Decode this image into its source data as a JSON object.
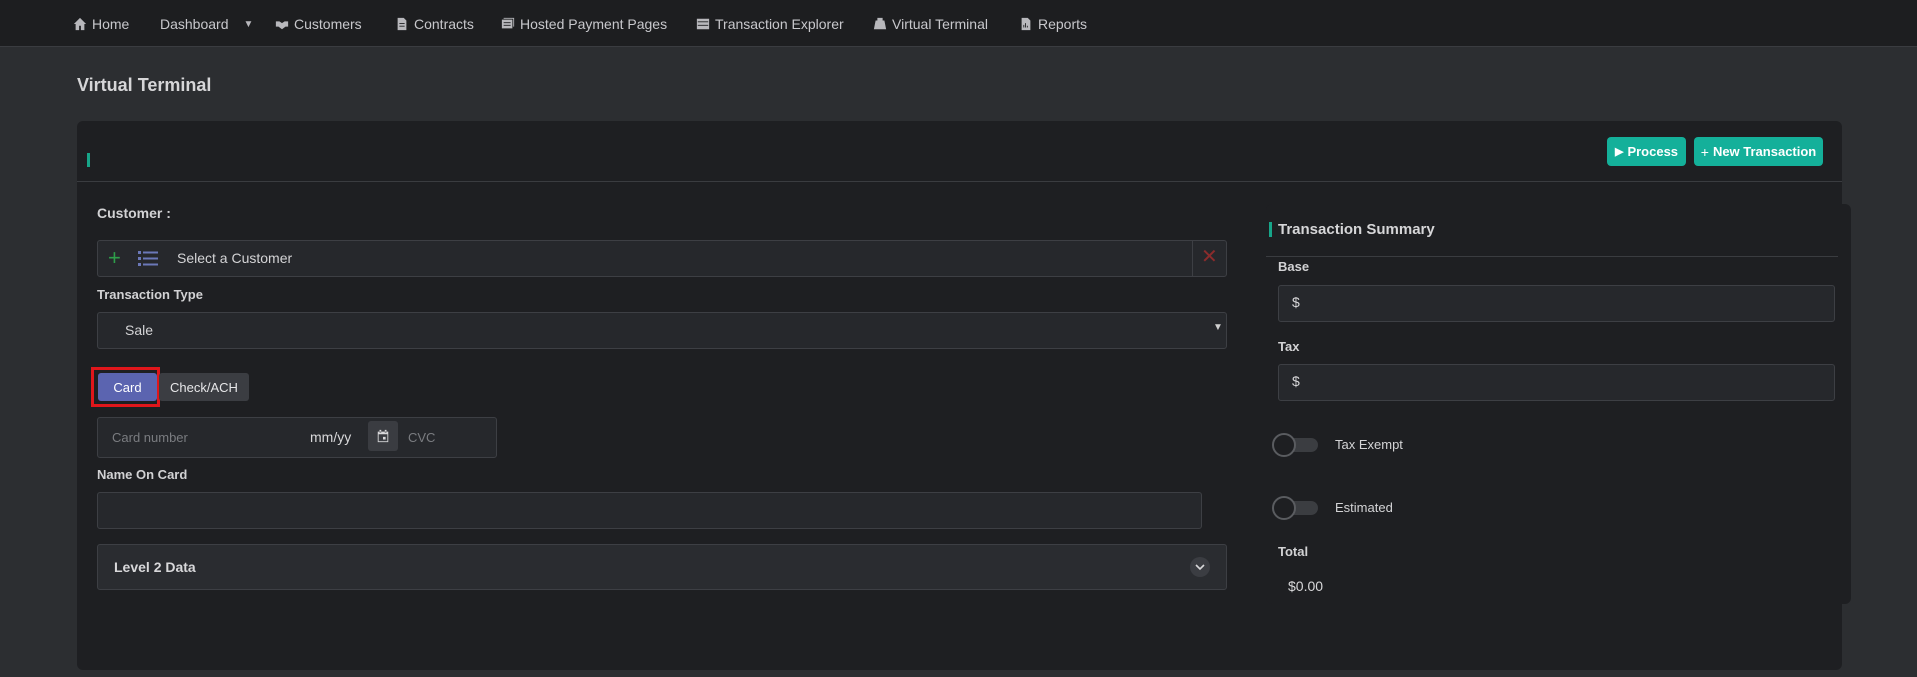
{
  "nav": {
    "home": "Home",
    "dashboard": "Dashboard",
    "customers": "Customers",
    "contracts": "Contracts",
    "hosted_payment_pages": "Hosted Payment Pages",
    "transaction_explorer": "Transaction Explorer",
    "virtual_terminal": "Virtual Terminal",
    "reports": "Reports"
  },
  "page_title": "Virtual Terminal",
  "header_buttons": {
    "process": "Process",
    "new_transaction": "New Transaction"
  },
  "customer": {
    "label": "Customer :",
    "placeholder": "Select a Customer"
  },
  "transaction_type": {
    "label": "Transaction Type",
    "value": "Sale"
  },
  "payment_method": {
    "card": "Card",
    "check_ach": "Check/ACH",
    "selected": "Card"
  },
  "card_fields": {
    "card_number_placeholder": "Card number",
    "expiry_placeholder": "mm/yy",
    "cvc_placeholder": "CVC"
  },
  "name_on_card": {
    "label": "Name On Card",
    "value": ""
  },
  "level2": {
    "label": "Level 2 Data"
  },
  "summary": {
    "title": "Transaction Summary",
    "base_label": "Base",
    "base_prefix": "$",
    "tax_label": "Tax",
    "tax_prefix": "$",
    "tax_exempt_label": "Tax Exempt",
    "estimated_label": "Estimated",
    "total_label": "Total",
    "total_value": "$0.00"
  },
  "colors": {
    "accent": "#14b09a",
    "selected_tab": "#5b64b0",
    "highlight": "#e0161b",
    "clear_icon": "#8b2c2c",
    "add_icon": "#2e9e4a"
  }
}
